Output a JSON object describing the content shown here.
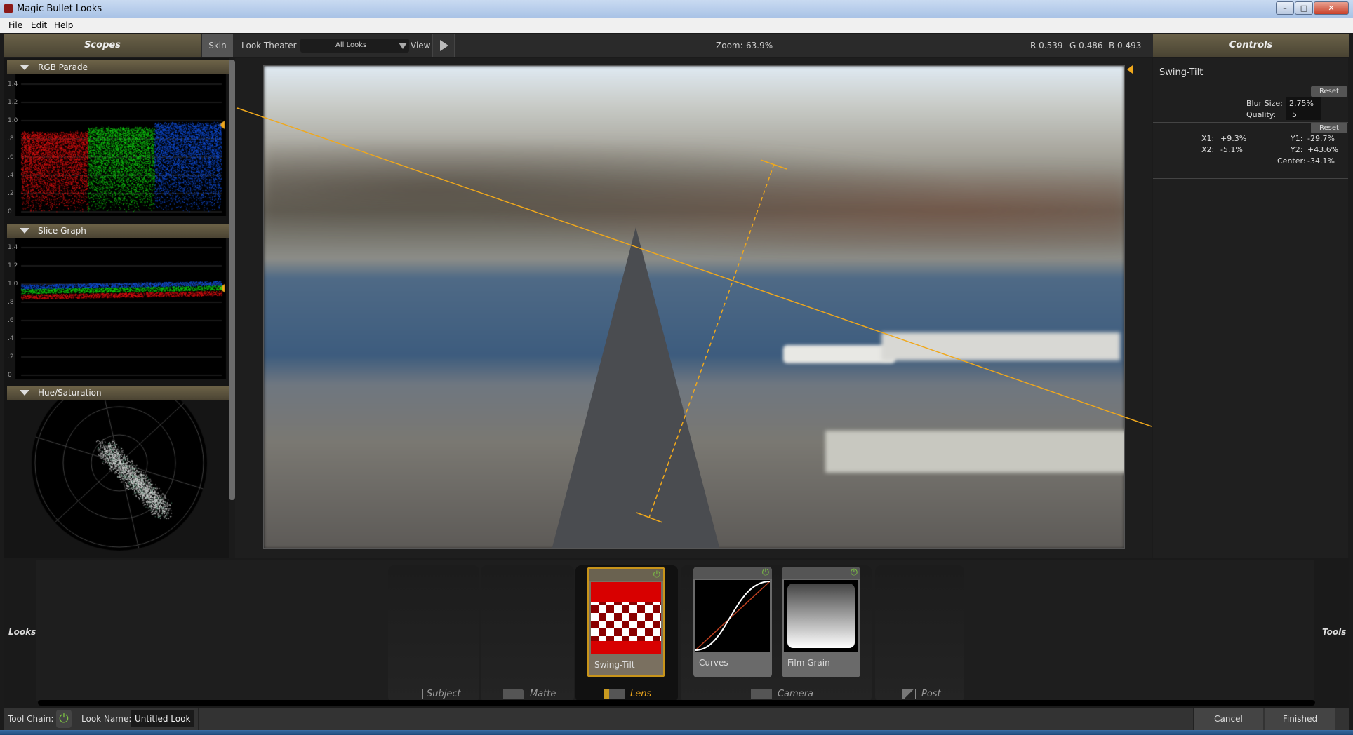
{
  "window": {
    "title": "Magic Bullet Looks",
    "minimize_icon": "minimize-icon",
    "maximize_icon": "maximize-icon",
    "close_icon": "close-icon"
  },
  "menu": {
    "file": "File",
    "edit": "Edit",
    "help": "Help"
  },
  "toolbar": {
    "scopes_label": "Scopes",
    "skin_label": "Skin",
    "look_theater_label": "Look Theater",
    "looks_filter": "All Looks",
    "view_label": "View",
    "zoom_label": "Zoom:",
    "zoom_value": "63.9%",
    "r_value": "R 0.539",
    "g_value": "G 0.486",
    "b_value": "B 0.493",
    "controls_label": "Controls"
  },
  "scopes": {
    "rgb_parade": {
      "title": "RGB Parade",
      "ticks": [
        "1.4",
        "1.2",
        "1.0",
        ".8",
        ".6",
        ".4",
        ".2",
        "0"
      ]
    },
    "slice_graph": {
      "title": "Slice Graph",
      "ticks": [
        "1.4",
        "1.2",
        "1.0",
        ".8",
        ".6",
        ".4",
        ".2",
        "0"
      ]
    },
    "hue_saturation": {
      "title": "Hue/Saturation"
    }
  },
  "controls": {
    "tool_name": "Swing-Tilt",
    "reset_label": "Reset",
    "blur_size_label": "Blur Size:",
    "blur_size_value": "2.75%",
    "quality_label": "Quality:",
    "quality_value": "5",
    "x1_label": "X1:",
    "x1_value": "+9.3%",
    "x2_label": "X2:",
    "x2_value": "-5.1%",
    "y1_label": "Y1:",
    "y1_value": "-29.7%",
    "y2_label": "Y2:",
    "y2_value": "+43.6%",
    "center_label": "Center:",
    "center_value": "-34.1%"
  },
  "toolchain": {
    "looks_label": "Looks",
    "tools_label": "Tools",
    "columns": [
      "Subject",
      "Matte",
      "Lens",
      "Camera",
      "Post"
    ],
    "active_column": "Lens",
    "cards": [
      {
        "name": "Swing-Tilt",
        "enabled": true,
        "selected": true
      },
      {
        "name": "Curves",
        "enabled": true,
        "selected": false
      },
      {
        "name": "Film Grain",
        "enabled": true,
        "selected": false
      }
    ]
  },
  "statusbar": {
    "tool_chain_label": "Tool Chain:",
    "look_name_label": "Look Name:",
    "look_name_value": "Untitled Look",
    "cancel_label": "Cancel",
    "finished_label": "Finished"
  },
  "colors": {
    "accent": "#f0a81c",
    "header_gold": "#6a6148",
    "power_green": "#7bc043"
  }
}
